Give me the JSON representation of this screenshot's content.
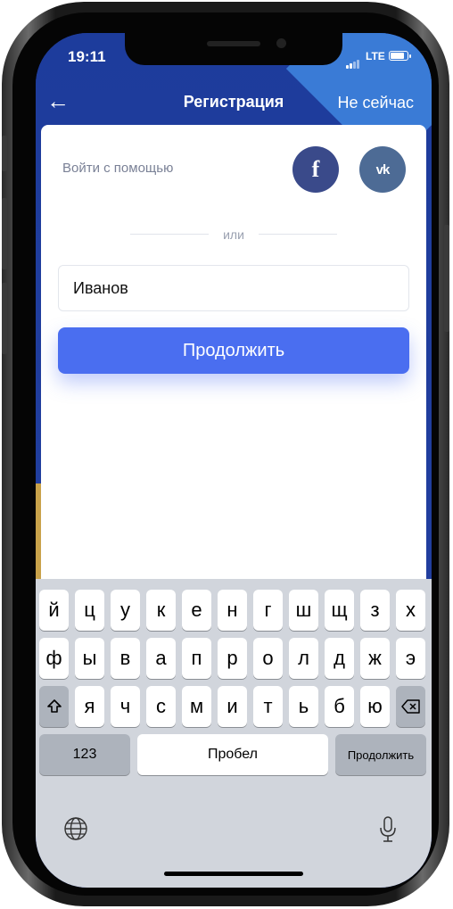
{
  "status": {
    "time": "19:11",
    "network": "LTE"
  },
  "nav": {
    "back_icon": "arrow-left-icon",
    "title": "Регистрация",
    "skip": "Не сейчас"
  },
  "card": {
    "login_with": "Войти с помощью",
    "facebook_icon": "f",
    "vk_icon": "vk",
    "divider_text": "или",
    "input_value": "Иванов",
    "continue_label": "Продолжить"
  },
  "keyboard": {
    "row1": [
      "й",
      "ц",
      "у",
      "к",
      "е",
      "н",
      "г",
      "ш",
      "щ",
      "з",
      "х"
    ],
    "row2": [
      "ф",
      "ы",
      "в",
      "а",
      "п",
      "р",
      "о",
      "л",
      "д",
      "ж",
      "э"
    ],
    "row3": [
      "я",
      "ч",
      "с",
      "м",
      "и",
      "т",
      "ь",
      "б",
      "ю"
    ],
    "numbers": "123",
    "space": "Пробел",
    "return": "Продолжить"
  },
  "colors": {
    "accent": "#4a6ef0",
    "header_bg": "#1d3c9c",
    "facebook": "#3a4a8a",
    "vk": "#4d6b95"
  }
}
